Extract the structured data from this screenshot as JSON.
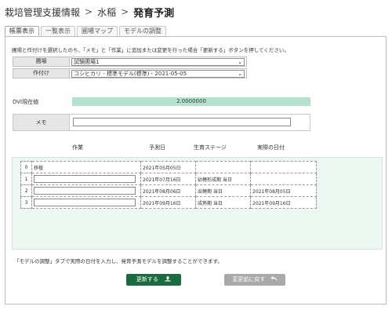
{
  "breadcrumb": {
    "items": [
      "栽培管理支援情報",
      "水稲"
    ],
    "separator": ">",
    "current": "発育予測"
  },
  "tabs": [
    "帳票表示",
    "一覧表示",
    "圃場マップ",
    "モデルの調整"
  ],
  "instruction": "圃場と作付けを選択したのち、「メモ」と「作業」に追加または変更を行った場合「更新する」ボタンを押してください。",
  "form": {
    "field_label": "圃場",
    "field_value": "試験圃場1",
    "crop_label": "作付け",
    "crop_value": "コシヒカリ - 標準モデル(標準) - 2021-05-05"
  },
  "dvi": {
    "label": "DVI現在値",
    "value": "2.0000000"
  },
  "memo": {
    "label": "メモ",
    "value": ""
  },
  "table": {
    "headers": {
      "task": "作業",
      "predicted": "予測日",
      "stage": "生育ステージ",
      "actual": "実際の日付"
    },
    "rows": [
      {
        "no": "0",
        "task": "移植",
        "predicted": "2021年05月05日",
        "stage": "",
        "actual": ""
      },
      {
        "no": "1",
        "task": "",
        "predicted": "2021年07月16日",
        "stage": "幼穂形成期 当日",
        "actual": ""
      },
      {
        "no": "2",
        "task": "",
        "predicted": "2021年08月06日",
        "stage": "出穂期 当日",
        "actual": "2021年08月05日"
      },
      {
        "no": "3",
        "task": "",
        "predicted": "2021年09月16日",
        "stage": "成熟期 当日",
        "actual": "2021年09月16日"
      }
    ]
  },
  "note": "「モデルの調整」タブで実際の日付を入力し、発育予測モデルを調整することができます。",
  "buttons": {
    "update": "更新する",
    "revert": "変更前に戻す"
  },
  "icons": {
    "update": "upload-icon",
    "revert": "undo-arrow-icon",
    "select": "chevron-down-icon"
  },
  "colors": {
    "primary": "#1a6b3d",
    "dvi_bar": "#b5e2cc",
    "grid_background": "#eef8f3",
    "disabled": "#a9a9a9"
  }
}
